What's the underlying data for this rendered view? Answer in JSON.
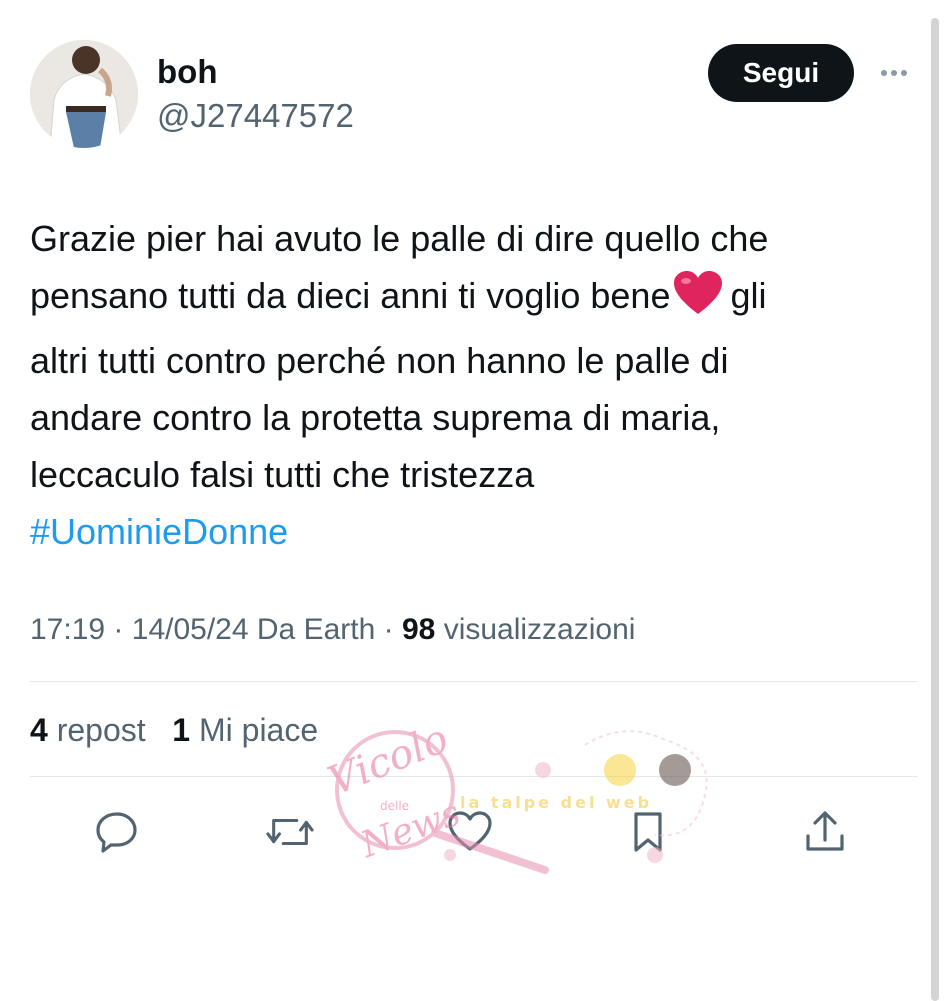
{
  "author": {
    "display_name": "boh",
    "handle": "@J27447572"
  },
  "follow_label": "Segui",
  "tweet": {
    "lines": [
      "Grazie pier hai avuto le palle di dire quello che",
      "pensano tutti da dieci anni ti voglio bene",
      "gli",
      "altri tutti contro perché non hanno le palle di",
      "andare contro la protetta suprema di maria,",
      "leccaculo falsi tutti che tristezza"
    ],
    "emoji": "red-heart-emoji",
    "hashtag": "#UominieDonne"
  },
  "meta": {
    "time": "17:19",
    "separator": "·",
    "date": "14/05/24",
    "source": "Da Earth",
    "views_count": "98",
    "views_label": "visualizzazioni"
  },
  "stats": {
    "reposts_count": "4",
    "reposts_label": "repost",
    "likes_count": "1",
    "likes_label": "Mi piace"
  },
  "actions": [
    "reply-icon",
    "repost-icon",
    "like-icon",
    "bookmark-icon",
    "share-icon"
  ],
  "watermark": {
    "logo_text_1": "Vicolo",
    "logo_text_2": "delle",
    "logo_text_3": "News",
    "banner_text": "la talpe del web"
  },
  "colors": {
    "text": "#0f1419",
    "secondary": "#536471",
    "link": "#1d9bf0",
    "button": "#0f1419",
    "heart": "#e0245e"
  }
}
